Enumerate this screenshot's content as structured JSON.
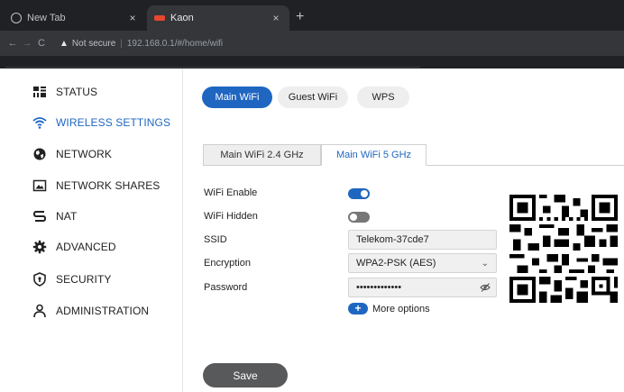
{
  "browser": {
    "tabs": [
      {
        "title": "New Tab",
        "close": "×"
      },
      {
        "title": "Kaon",
        "close": "×"
      }
    ],
    "new_tab": "+",
    "nav": {
      "back": "←",
      "forward": "→",
      "reload": "C"
    },
    "security_icon": "▲",
    "security_label": "Not secure",
    "separator": "|",
    "url": "192.168.0.1/#/home/wifi"
  },
  "sidebar": {
    "items": [
      {
        "label": "STATUS",
        "icon": "status-icon"
      },
      {
        "label": "WIRELESS SETTINGS",
        "icon": "wifi-icon",
        "active": true
      },
      {
        "label": "NETWORK",
        "icon": "globe-icon"
      },
      {
        "label": "NETWORK SHARES",
        "icon": "share-icon"
      },
      {
        "label": "NAT",
        "icon": "nat-icon"
      },
      {
        "label": "ADVANCED",
        "icon": "gear-icon"
      },
      {
        "label": "SECURITY",
        "icon": "shield-icon"
      },
      {
        "label": "ADMINISTRATION",
        "icon": "user-icon"
      }
    ]
  },
  "tabs": [
    {
      "label": "Main WiFi",
      "active": true
    },
    {
      "label": "Guest WiFi"
    },
    {
      "label": "WPS"
    }
  ],
  "subtabs": [
    {
      "label": "Main WiFi 2.4 GHz"
    },
    {
      "label": "Main WiFi 5 GHz",
      "active": true
    }
  ],
  "form": {
    "wifi_enable": {
      "label": "WiFi Enable",
      "value": true
    },
    "wifi_hidden": {
      "label": "WiFi Hidden",
      "value": false
    },
    "ssid": {
      "label": "SSID",
      "value": "Telekom-37cde7"
    },
    "encryption": {
      "label": "Encryption",
      "value": "WPA2-PSK (AES)",
      "chevron": "⌄"
    },
    "password": {
      "label": "Password",
      "value": "•••••••••••••"
    },
    "more_options": {
      "icon": "+",
      "label": "More options"
    }
  },
  "save_label": "Save",
  "colors": {
    "accent": "#1f66c1",
    "save": "#58595b",
    "browser_dark": "#202124"
  }
}
